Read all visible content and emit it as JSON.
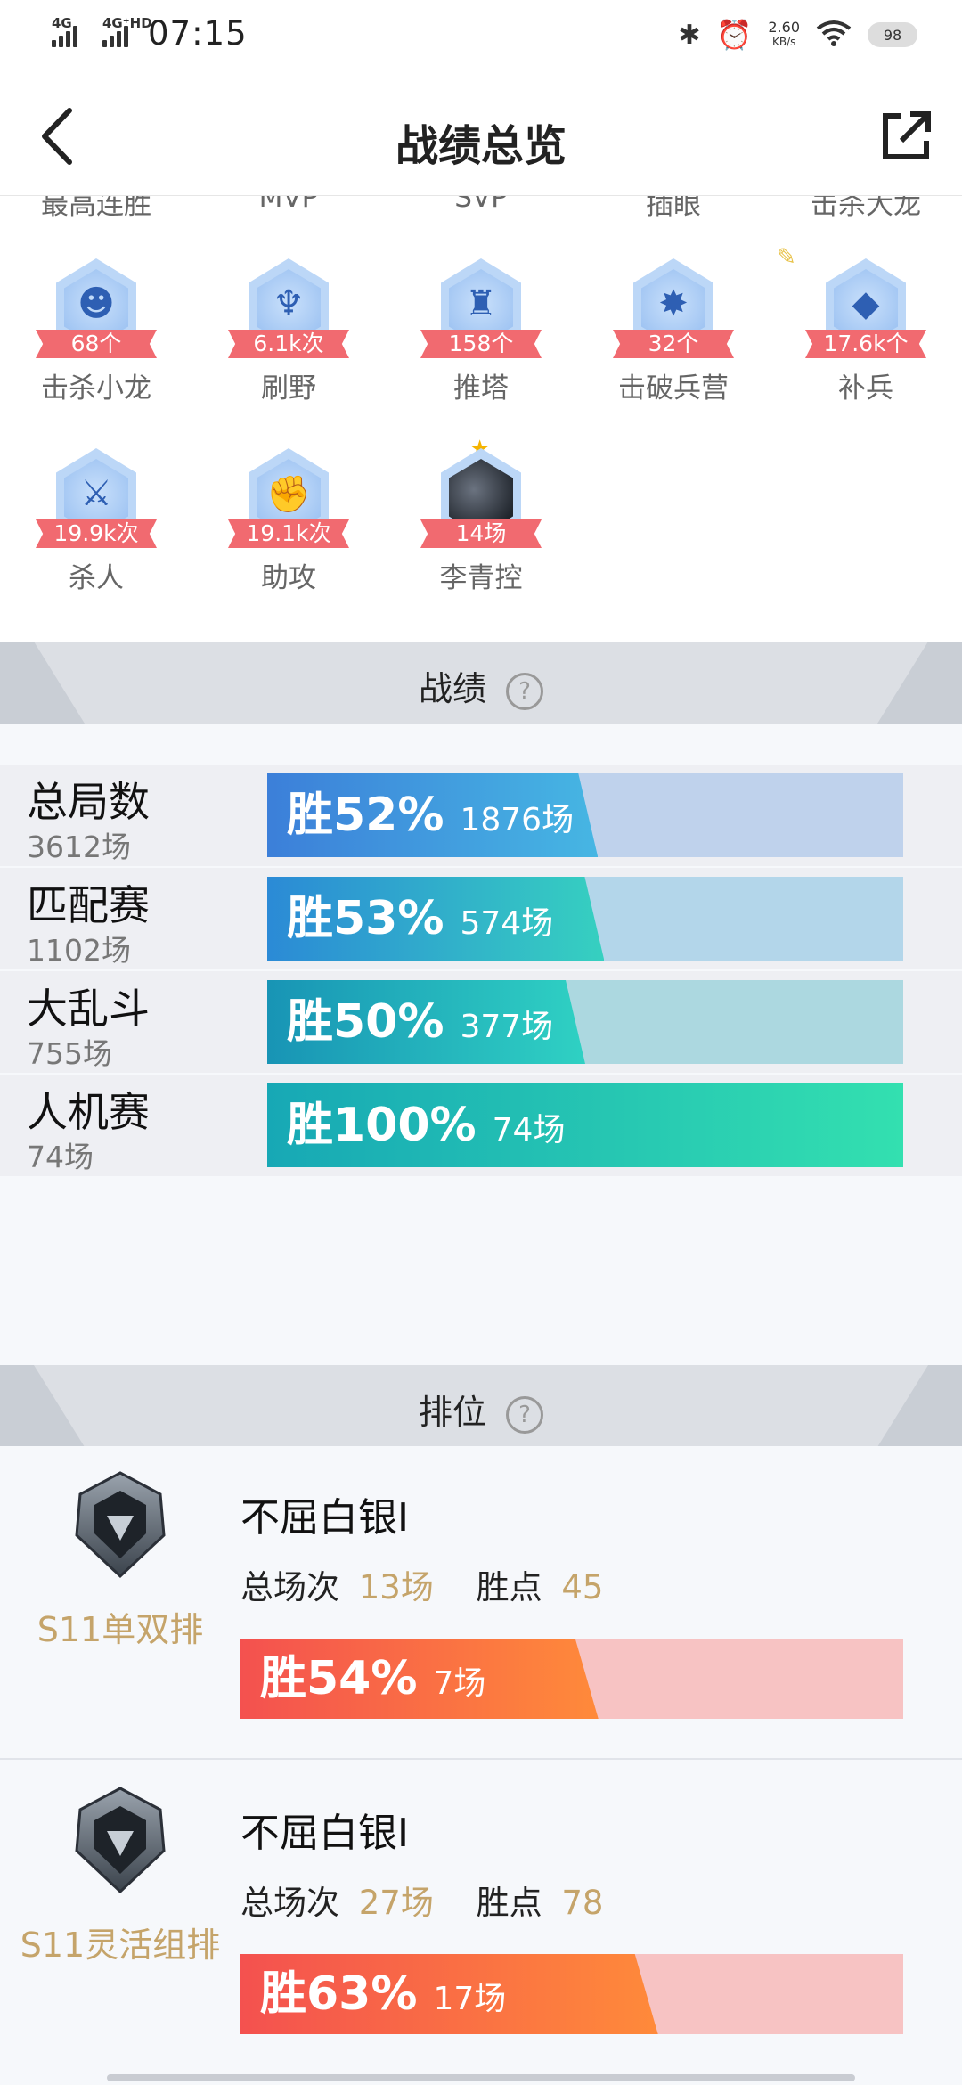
{
  "status_bar": {
    "sim1": "4G",
    "sim2": "4G⁺HD",
    "time": "07:15",
    "speed_value": "2.60",
    "speed_unit": "KB/s",
    "battery": "98"
  },
  "header": {
    "title": "战绩总览"
  },
  "achievements": {
    "top_row": [
      "最高连胜",
      "MVP",
      "SVP",
      "插眼",
      "击杀大龙"
    ],
    "badges": [
      {
        "count": "68个",
        "label": "击杀小龙",
        "icon": "dragon-icon"
      },
      {
        "count": "6.1k次",
        "label": "刷野",
        "icon": "jungle-icon"
      },
      {
        "count": "158个",
        "label": "推塔",
        "icon": "tower-icon"
      },
      {
        "count": "32个",
        "label": "击破兵营",
        "icon": "barracks-icon"
      },
      {
        "count": "17.6k个",
        "label": "补兵",
        "icon": "minion-icon"
      },
      {
        "count": "19.9k次",
        "label": "杀人",
        "icon": "kill-icon"
      },
      {
        "count": "19.1k次",
        "label": "助攻",
        "icon": "assist-icon"
      },
      {
        "count": "14场",
        "label": "李青控",
        "icon": "champion-portrait"
      }
    ]
  },
  "stats_section": {
    "title": "战绩",
    "rows": [
      {
        "name": "总局数",
        "count": "3612场",
        "win_label": "胜52%",
        "games": "1876场",
        "win_rate": 0.52,
        "color_from": "#3c7fd9",
        "color_to": "#46b6e3",
        "track": "#bfd2ec"
      },
      {
        "name": "匹配赛",
        "count": "1102场",
        "win_label": "胜53%",
        "games": "574场",
        "win_rate": 0.53,
        "color_from": "#2b8ad6",
        "color_to": "#36d0c0",
        "track": "#b3d6ea"
      },
      {
        "name": "大乱斗",
        "count": "755场",
        "win_label": "胜50%",
        "games": "377场",
        "win_rate": 0.5,
        "color_from": "#1894b5",
        "color_to": "#2fd1c3",
        "track": "#acd8e0"
      },
      {
        "name": "人机赛",
        "count": "74场",
        "win_label": "胜100%",
        "games": "74场",
        "win_rate": 1.0,
        "color_from": "#17a8b5",
        "color_to": "#33e0b0",
        "track": "#b0e6da"
      }
    ]
  },
  "rank_section": {
    "title": "排位",
    "entries": [
      {
        "season": "S11单双排",
        "tier": "不屈白银I",
        "total_label": "总场次",
        "total": "13场",
        "points_label": "胜点",
        "points": "45",
        "win_label": "胜54%",
        "games": "7场",
        "win_rate": 0.54
      },
      {
        "season": "S11灵活组排",
        "tier": "不屈白银I",
        "total_label": "总场次",
        "total": "27场",
        "points_label": "胜点",
        "points": "78",
        "win_label": "胜63%",
        "games": "17场",
        "win_rate": 0.63
      }
    ]
  }
}
